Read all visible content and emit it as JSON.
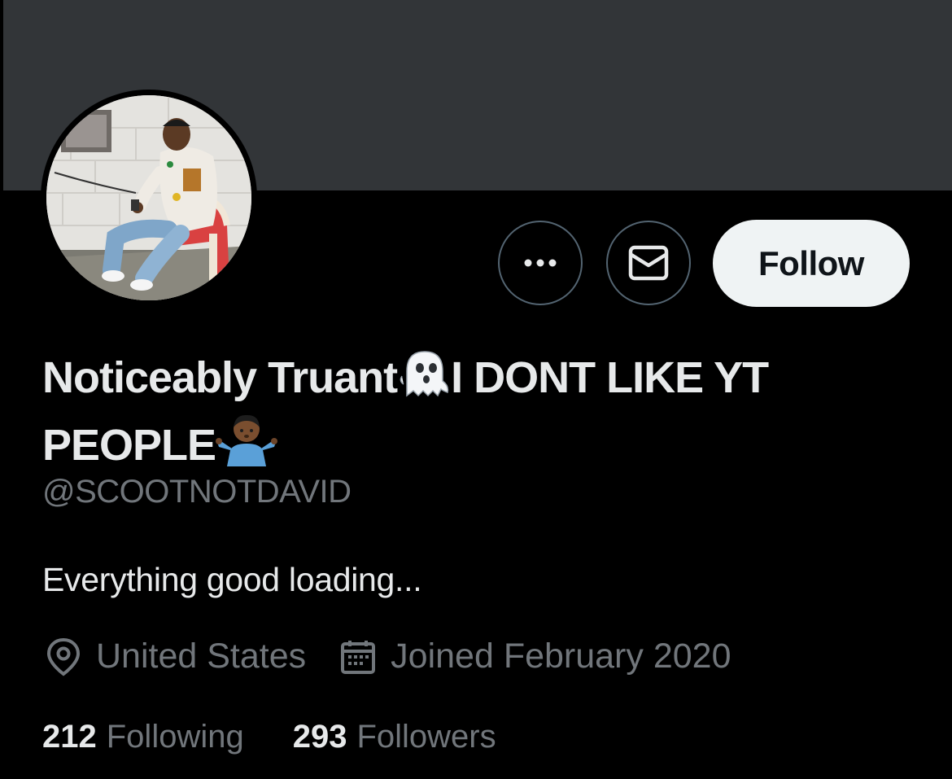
{
  "profile": {
    "display_name_part1": "Noticeably Truant",
    "display_name_emoji1": "ghost-emoji",
    "display_name_part2": "I DONT LIKE YT PEOPLE",
    "display_name_emoji2": "person-shrugging-emoji",
    "handle": "@SCOOTNOTDAVID",
    "bio": "Everything good loading...",
    "location": "United States",
    "joined": "Joined February 2020",
    "following_count": "212",
    "following_label": "Following",
    "followers_count": "293",
    "followers_label": "Followers"
  },
  "actions": {
    "more_icon": "more-dots-icon",
    "message_icon": "envelope-icon",
    "follow_label": "Follow"
  },
  "icons": {
    "location": "location-pin-icon",
    "calendar": "calendar-icon"
  },
  "colors": {
    "background": "#000000",
    "banner": "#323538",
    "primary_text": "#e7e9ea",
    "secondary_text": "#71767b",
    "button_border": "#536471",
    "follow_button_bg": "#eff3f4",
    "follow_button_text": "#0f1419"
  }
}
